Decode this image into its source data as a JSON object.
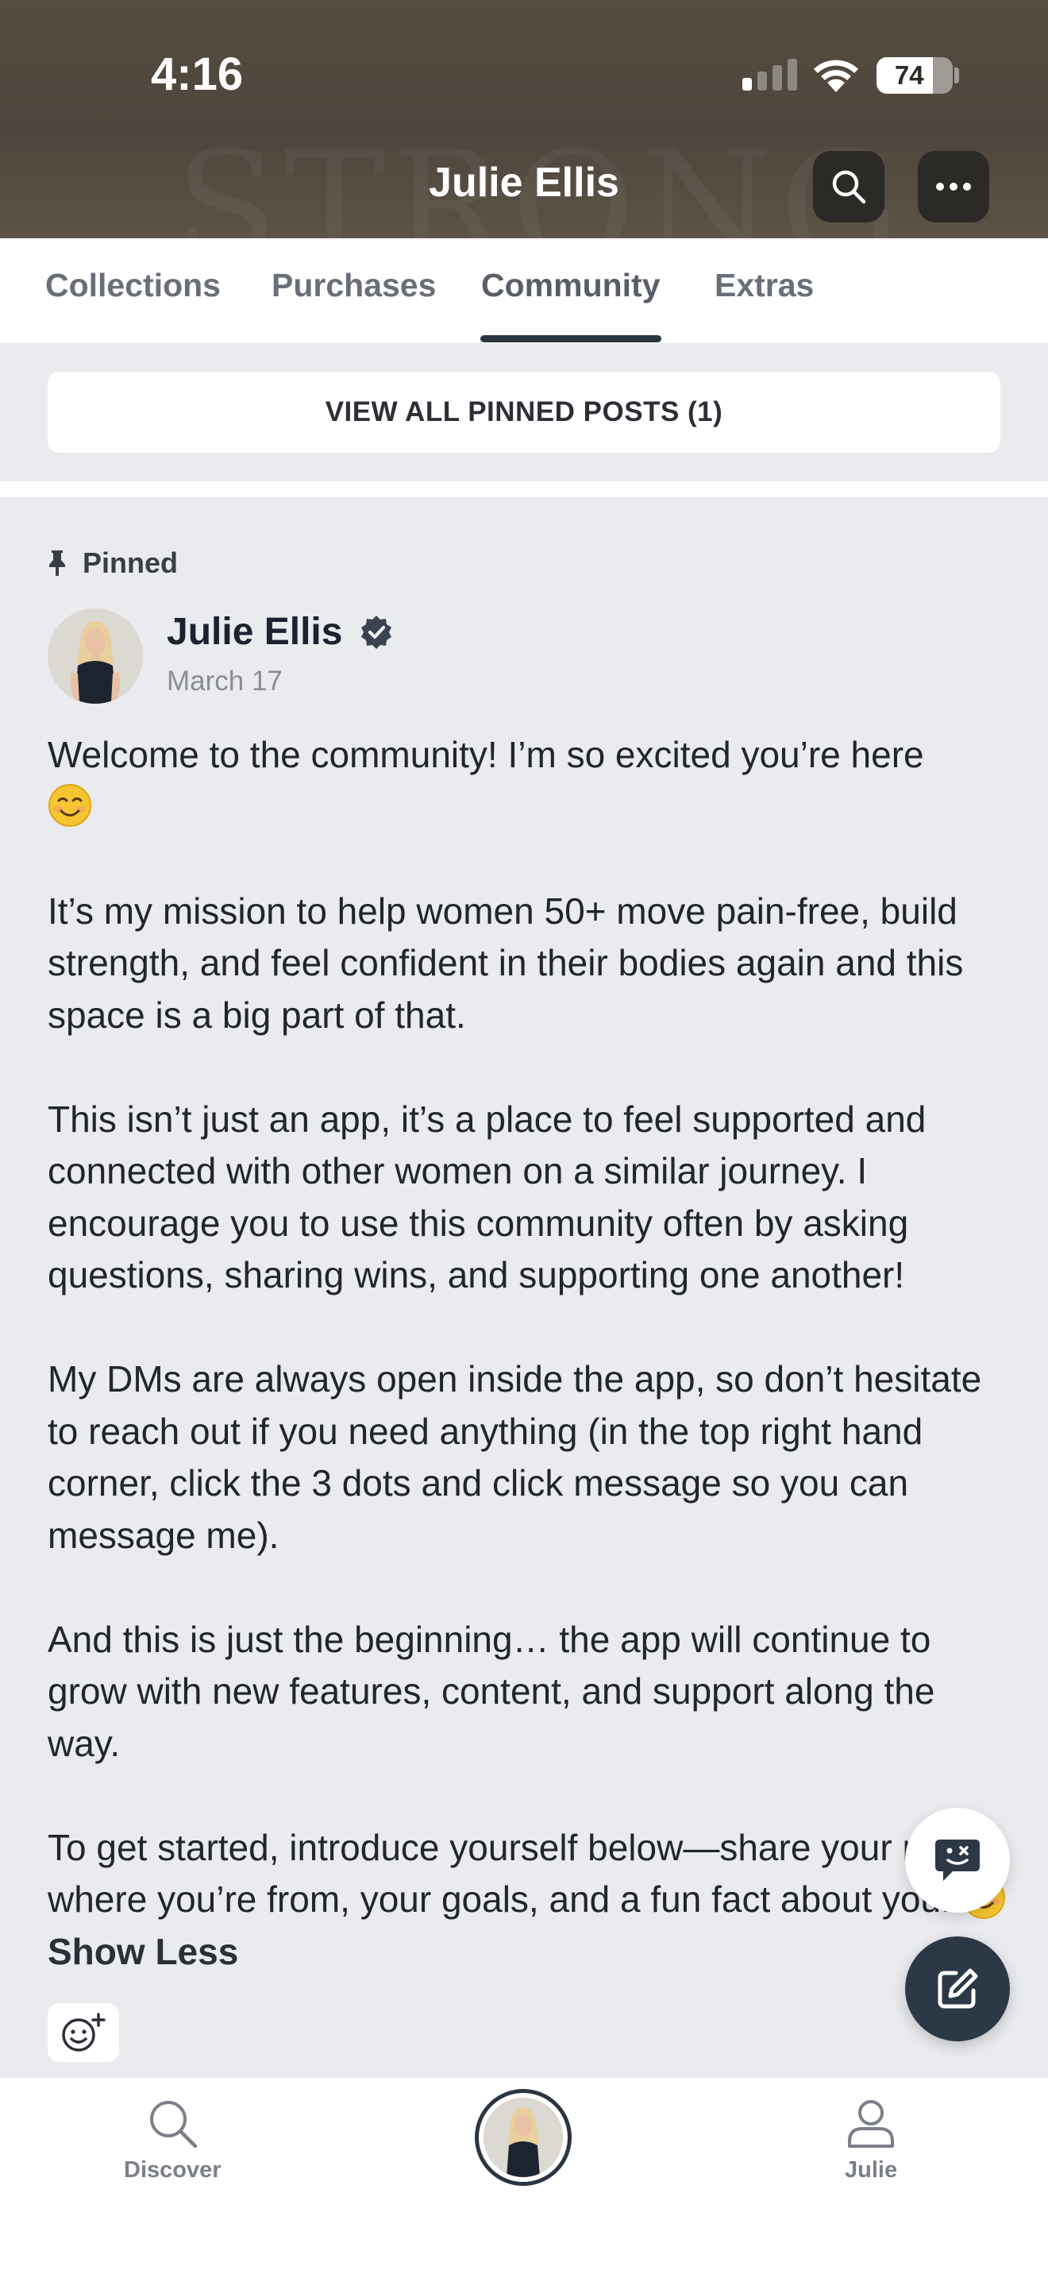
{
  "status_bar": {
    "time": "4:16",
    "battery": "74",
    "battery_level": 0.74,
    "signal_bars": 1
  },
  "header": {
    "title": "Julie Ellis",
    "watermark": "STRONG"
  },
  "tabs": [
    {
      "label": "Collections"
    },
    {
      "label": "Purchases"
    },
    {
      "label": "Community",
      "active": true
    },
    {
      "label": "Extras"
    }
  ],
  "pinned_bar": {
    "label": "VIEW ALL PINNED POSTS (1)"
  },
  "post": {
    "pinned_label": "Pinned",
    "author": "Julie Ellis",
    "verified": true,
    "date": "March 17",
    "paragraphs": [
      "Welcome to the community! I’m so excited you’re here",
      "It’s my mission to help women 50+ move pain-free, build strength, and feel confident in their bodies again and this space is a big part of that.",
      "This isn’t just an app, it’s a place to feel supported and connected with other women on a similar journey. I encourage you to use this community often by asking questions, sharing wins, and supporting one another!",
      "My DMs are always open inside the app, so don’t hesitate to reach out if you need anything (in the top right hand corner, click the 3 dots and click message so you can message me).",
      "And this is just the beginning… the app will continue to grow with new features, content, and support along the way.",
      "To get started, introduce yourself below—share your name, where you’re from, your goals, and a fun fact about you!"
    ],
    "show_less": "Show Less"
  },
  "bottom_nav": {
    "discover": "Discover",
    "profile": "Julie"
  },
  "colors": {
    "header_bg": "#554c41",
    "accent": "#2b3541",
    "page_bg": "#e9ebee"
  }
}
